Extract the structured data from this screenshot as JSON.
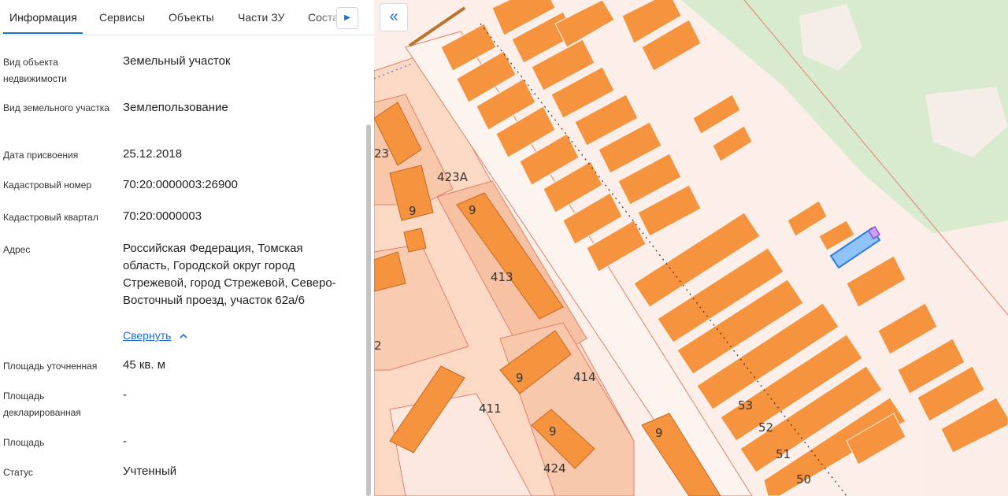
{
  "tabs": {
    "items": [
      {
        "label": "Информация",
        "active": true
      },
      {
        "label": "Сервисы"
      },
      {
        "label": "Объекты"
      },
      {
        "label": "Части ЗУ"
      },
      {
        "label": "Соста"
      }
    ],
    "next_icon": "triangle-right-icon"
  },
  "info": {
    "rows": [
      {
        "label": "Вид объекта недвижимости",
        "value": "Земельный участок"
      },
      {
        "label": "Вид земельного участка",
        "value": "Землепользование"
      },
      {
        "label": "Дата присвоения",
        "value": "25.12.2018"
      },
      {
        "label": "Кадастровый номер",
        "value": "70:20:0000003:26900"
      },
      {
        "label": "Кадастровый квартал",
        "value": "70:20:0000003"
      },
      {
        "label": "Адрес",
        "value": "Российская Федерация, Томская область, Городской округ город Стрежевой, город Стрежевой, Северо-Восточный проезд, участок 62а/6"
      },
      {
        "label": "Площадь уточненная",
        "value": "45 кв. м"
      },
      {
        "label": "Площадь декларированная",
        "value": "-"
      },
      {
        "label": "Площадь",
        "value": "-"
      },
      {
        "label": "Статус",
        "value": "Учтенный"
      }
    ],
    "collapse_label": "Свернуть"
  },
  "map": {
    "collapse_icon": "double-chevron-left-icon",
    "labels": {
      "l423": "23",
      "l423a": "423А",
      "l413": "413",
      "l414": "414",
      "l411": "411",
      "l424": "424",
      "l2": "2",
      "n9a": "9",
      "n9b": "9",
      "n9c": "9",
      "n9d": "9",
      "n9e": "9",
      "n53": "53",
      "n52": "52",
      "n51": "51",
      "n50": "50"
    },
    "colors": {
      "building": "#f5933f",
      "parcel_line": "#e0806a",
      "forest": "#d9ebcf",
      "highlight": "#2a7de1",
      "accent": "#1d6fd8"
    }
  }
}
